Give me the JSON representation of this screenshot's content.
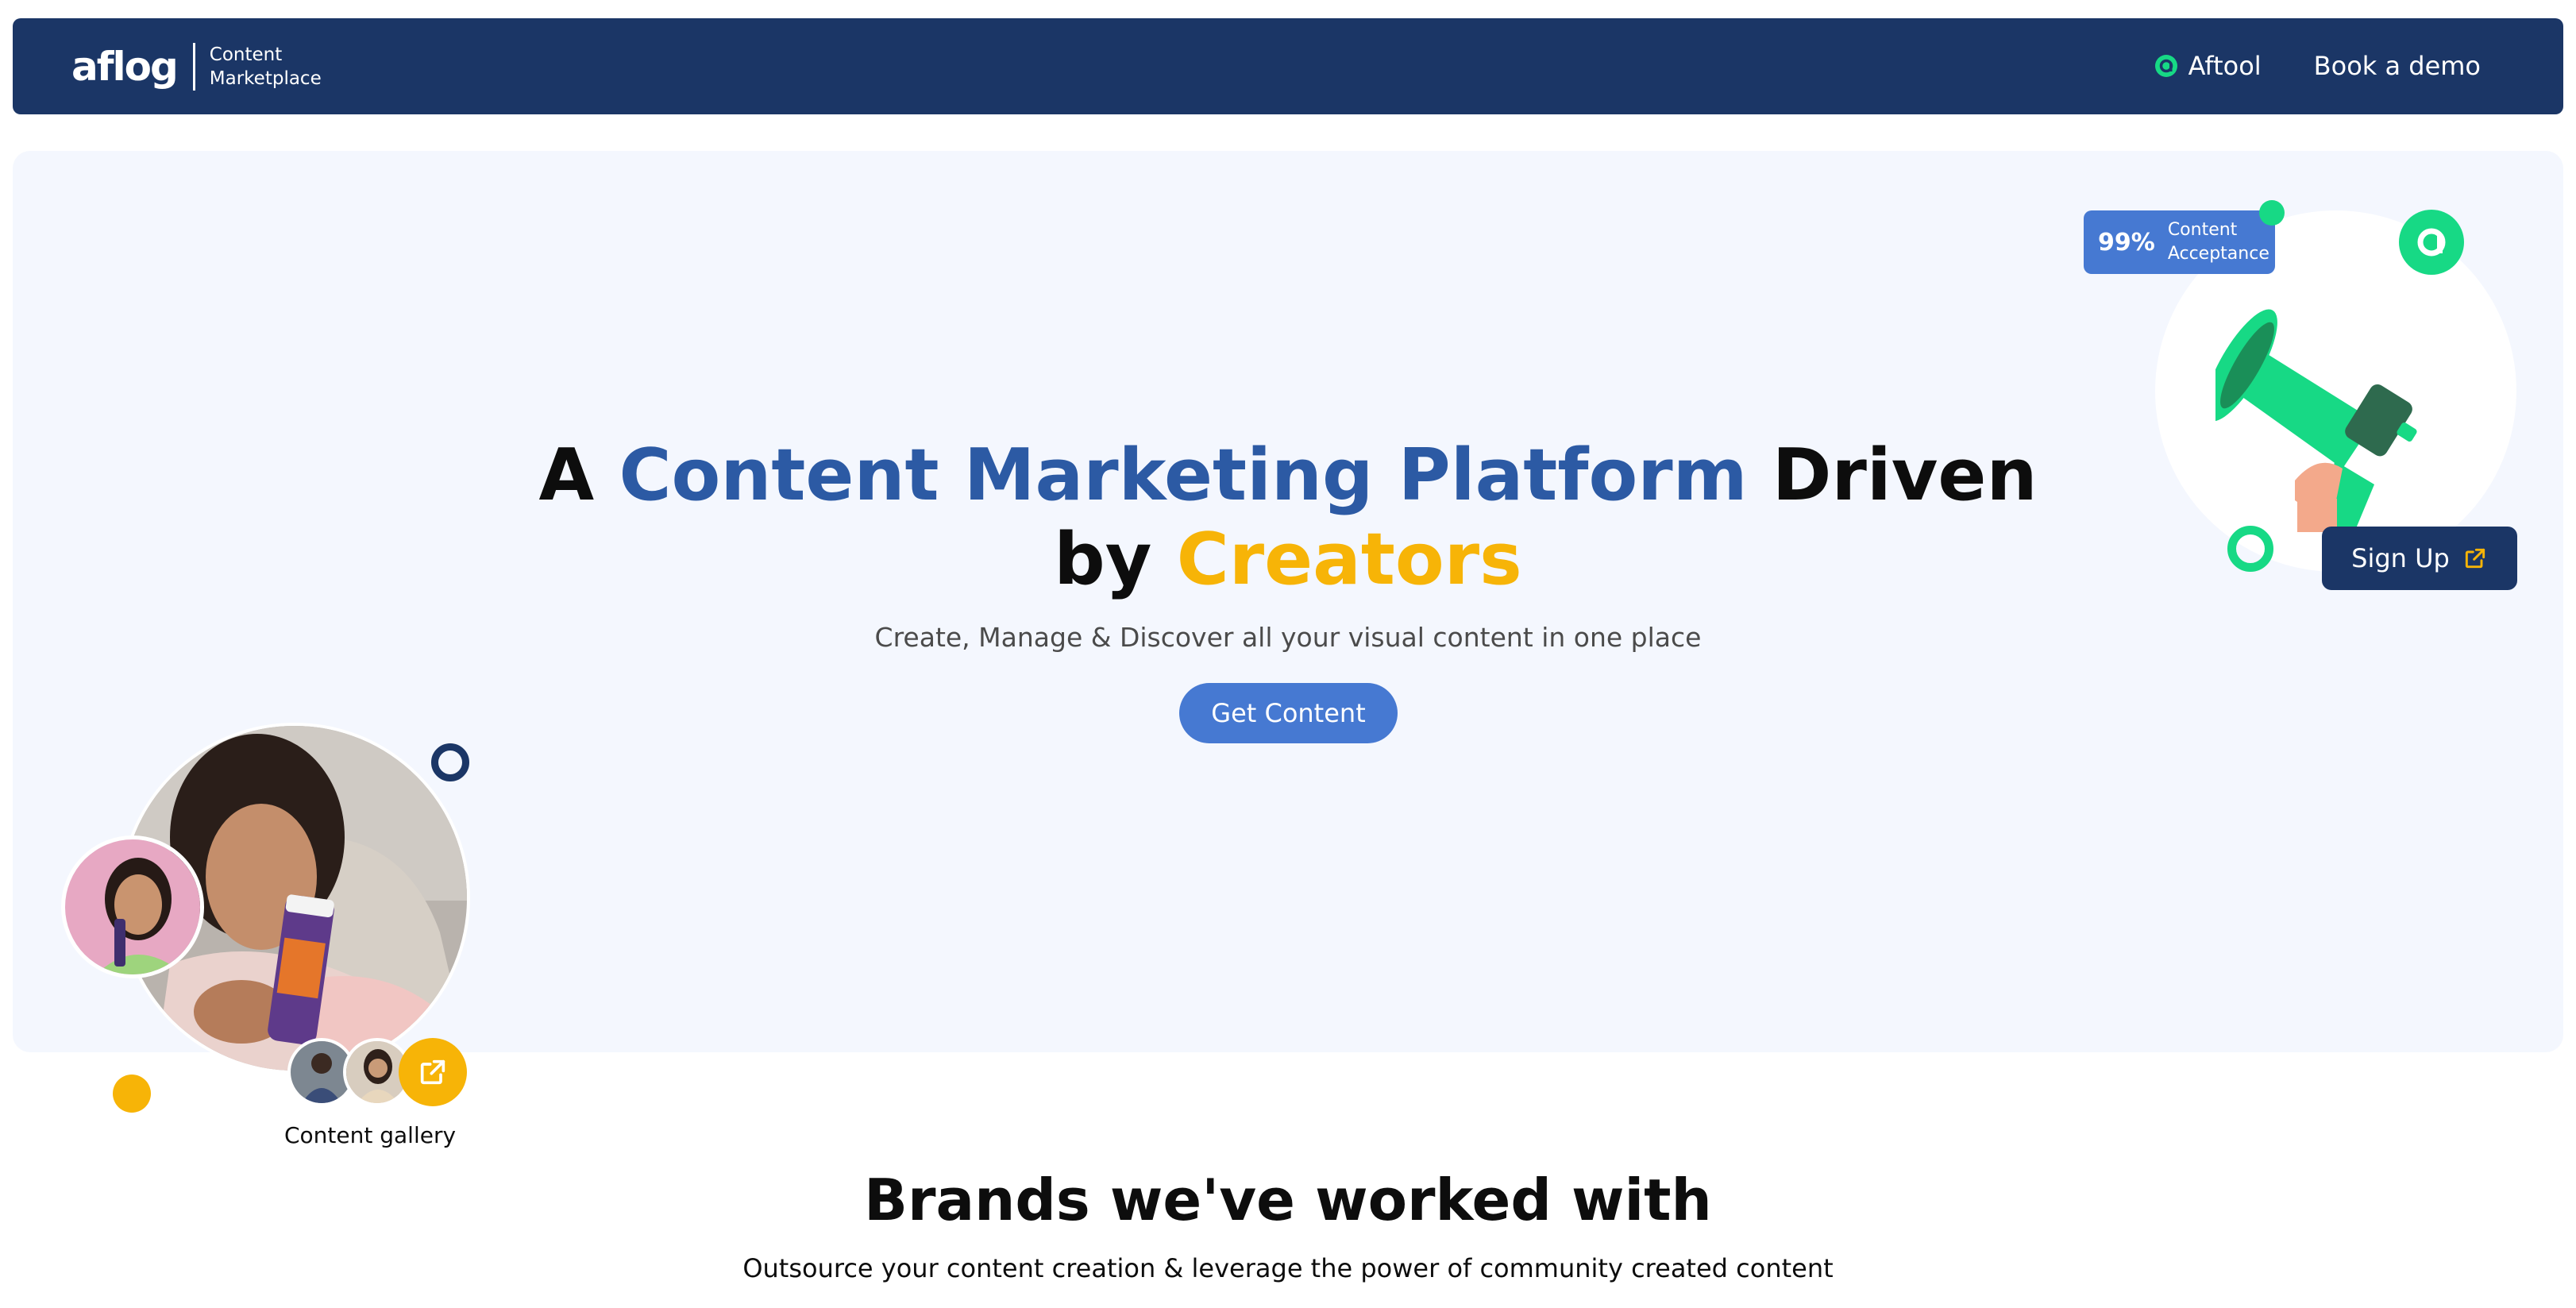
{
  "header": {
    "logo_text": "aflog",
    "logo_subtitle_line1": "Content",
    "logo_subtitle_line2": "Marketplace",
    "nav": [
      {
        "label": "Aftool",
        "icon": "aftool-logo-icon"
      },
      {
        "label": "Book a demo"
      }
    ]
  },
  "hero": {
    "title_part1": "A ",
    "title_highlight_blue": "Content Marketing Platform",
    "title_part2": " Driven",
    "title_part3": "by ",
    "title_highlight_yellow": "Creators",
    "subtitle": "Create, Manage & Discover all your visual content in one place",
    "cta_label": "Get Content"
  },
  "gallery": {
    "label": "Content gallery",
    "link_icon": "external-link-icon"
  },
  "promo": {
    "badge_value": "99%",
    "badge_label_line1": "Content",
    "badge_label_line2": "Acceptance",
    "signup_label": "Sign Up",
    "signup_icon": "external-link-icon",
    "illustration": "megaphone-icon"
  },
  "brands": {
    "title": "Brands we've worked with",
    "subtitle": "Outsource your content creation & leverage the power of community created content"
  },
  "colors": {
    "navy": "#1b3666",
    "blue": "#2c5aa4",
    "button_blue": "#4679d2",
    "yellow": "#f7b407",
    "green": "#17d985",
    "hero_bg": "#f4f7fe"
  }
}
